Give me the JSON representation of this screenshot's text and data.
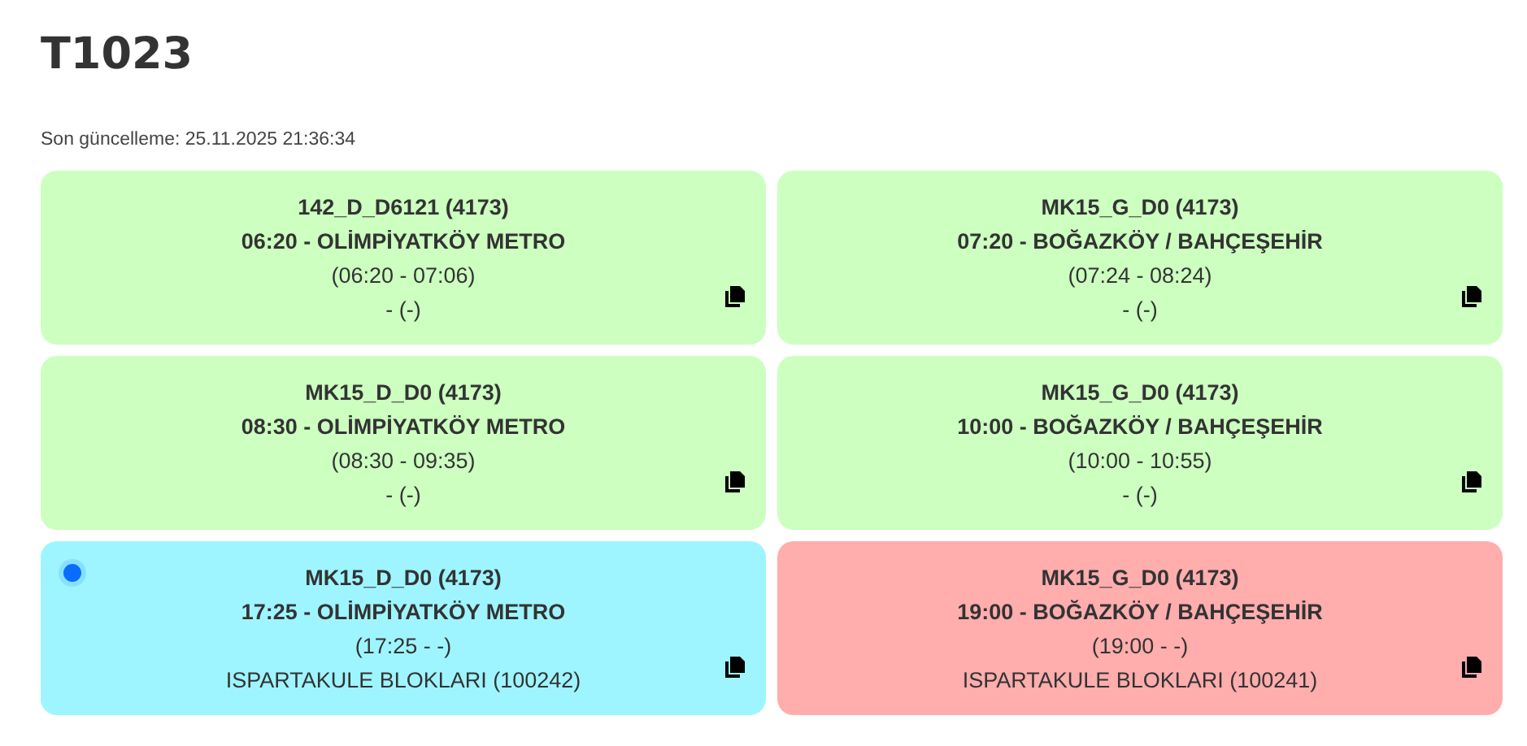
{
  "title": "T1023",
  "last_update": "Son güncelleme: 25.11.2025 21:36:34",
  "trips": [
    {
      "route": "142_D_D6121 (4173)",
      "departure": "06:20 - OLİMPİYATKÖY METRO",
      "times": "(06:20 - 07:06)",
      "stop": "- (-)",
      "color": "#ccffc0",
      "live": false
    },
    {
      "route": "MK15_G_D0 (4173)",
      "departure": "07:20 - BOĞAZKÖY / BAHÇEŞEHİR",
      "times": "(07:24 - 08:24)",
      "stop": "- (-)",
      "color": "#ccffc0",
      "live": false
    },
    {
      "route": "MK15_D_D0 (4173)",
      "departure": "08:30 - OLİMPİYATKÖY METRO",
      "times": "(08:30 - 09:35)",
      "stop": "- (-)",
      "color": "#ccffc0",
      "live": false
    },
    {
      "route": "MK15_G_D0 (4173)",
      "departure": "10:00 - BOĞAZKÖY / BAHÇEŞEHİR",
      "times": "(10:00 - 10:55)",
      "stop": "- (-)",
      "color": "#ccffc0",
      "live": false
    },
    {
      "route": "MK15_D_D0 (4173)",
      "departure": "17:25 - OLİMPİYATKÖY METRO",
      "times": "(17:25 - -)",
      "stop": "ISPARTAKULE BLOKLARI (100242)",
      "color": "#9ef5ff",
      "live": true
    },
    {
      "route": "MK15_G_D0 (4173)",
      "departure": "19:00 - BOĞAZKÖY / BAHÇEŞEHİR",
      "times": "(19:00 - -)",
      "stop": "ISPARTAKULE BLOKLARI (100241)",
      "color": "#ffadad",
      "live": false
    }
  ]
}
